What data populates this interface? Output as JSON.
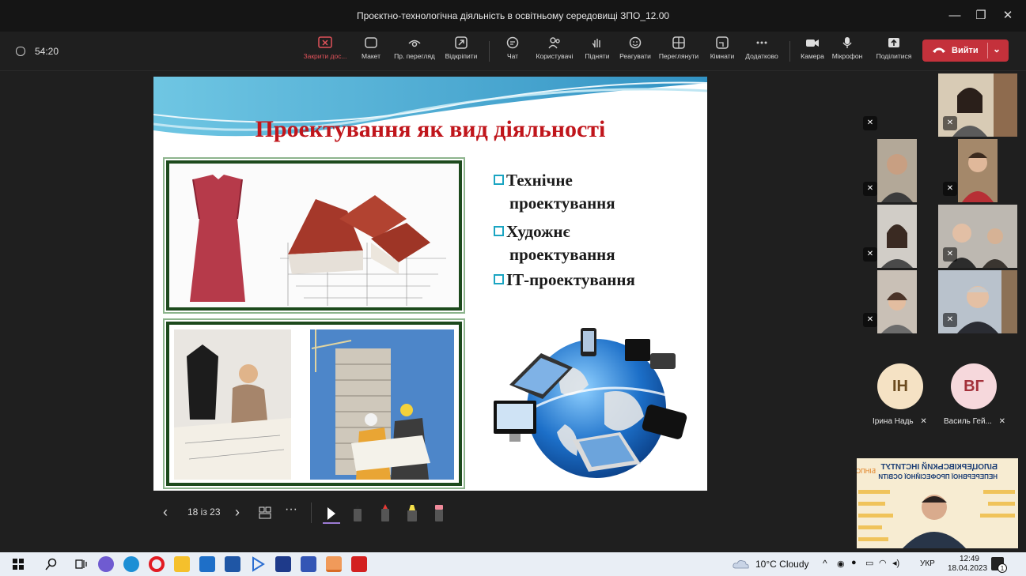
{
  "window": {
    "title": "Проєктно-технологічна діяльність в освітньому середовищі ЗПО_12.00",
    "minimize": "—",
    "maximize": "❐",
    "close": "✕"
  },
  "toolbar": {
    "timer": "54:20",
    "items": [
      {
        "label": "Закрити дос..."
      },
      {
        "label": "Макет"
      },
      {
        "label": "Пр. перегляд"
      },
      {
        "label": "Відкріпити"
      },
      {
        "label": "Чат"
      },
      {
        "label": "Користувачі"
      },
      {
        "label": "Підняти"
      },
      {
        "label": "Реагувати"
      },
      {
        "label": "Переглянути"
      },
      {
        "label": "Кімнати"
      },
      {
        "label": "Додатково"
      },
      {
        "label": "Камера"
      },
      {
        "label": "Мікрофон"
      },
      {
        "label": "Поділитися"
      }
    ],
    "leave_label": "Вийти"
  },
  "slide": {
    "title": "Проектування як вид діяльності",
    "bullets": [
      "Технічне",
      "проектування",
      "Художнє",
      "проектування",
      "ІТ-проектування"
    ]
  },
  "presenter": {
    "page": "18 із 23"
  },
  "participants": [
    {
      "initials": "ІН",
      "name": "Ірина Надь",
      "color": "#f5e2c4",
      "text_color": "#6b4b20"
    },
    {
      "initials": "ВГ",
      "name": "Василь Гей...",
      "color": "#f6d8dc",
      "text_color": "#a3303a"
    }
  ],
  "banner": {
    "line1": "БІЛОЦЕРКІВСЬКИЙ ІНСТИТУТ",
    "line2": "НЕПЕРЕРВНОЇ ПРОФЕСІЙНОЇ ОСВІТИ",
    "brand": "БІНПО"
  },
  "taskbar": {
    "weather": "10°C  Cloudy",
    "lang": "УКР",
    "time": "12:49",
    "date": "18.04.2023",
    "notify_count": "1"
  }
}
